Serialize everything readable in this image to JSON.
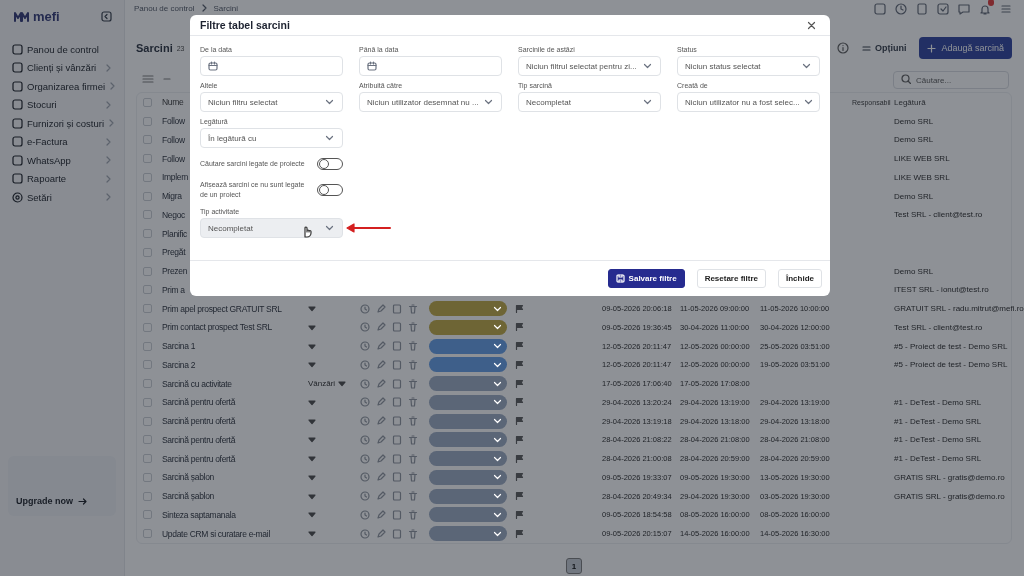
{
  "sidebar": {
    "logo": "mefi",
    "items": [
      {
        "label": "Panou de control",
        "has_submenu": false
      },
      {
        "label": "Clienți și vânzări",
        "has_submenu": true
      },
      {
        "label": "Organizarea firmei",
        "has_submenu": true
      },
      {
        "label": "Stocuri",
        "has_submenu": true
      },
      {
        "label": "Furnizori și costuri",
        "has_submenu": true
      },
      {
        "label": "e-Factura",
        "has_submenu": true
      },
      {
        "label": "WhatsApp",
        "has_submenu": true
      },
      {
        "label": "Rapoarte",
        "has_submenu": true
      },
      {
        "label": "Setări",
        "has_submenu": true
      }
    ],
    "upgrade_link": "Upgrade now"
  },
  "breadcrumb": [
    "Panou de control",
    "Sarcini"
  ],
  "page": {
    "title": "Sarcini",
    "count": "23",
    "options_button": "Opțiuni",
    "add_button": "Adaugă sarcină",
    "search_placeholder": "Căutare..."
  },
  "table": {
    "columns": [
      "Nume",
      "Responsabil",
      "Legătură"
    ],
    "header_checked": false,
    "rows": [
      {
        "kind": "partial",
        "checked": false,
        "name": "Follow",
        "link": "Demo SRL"
      },
      {
        "kind": "partial",
        "checked": false,
        "name": "Follow",
        "link": "Demo SRL"
      },
      {
        "kind": "partial",
        "checked": false,
        "name": "Follow",
        "link": "LIKE WEB SRL"
      },
      {
        "kind": "partial",
        "checked": false,
        "name": "Implem",
        "link": "LIKE WEB SRL"
      },
      {
        "kind": "partial",
        "checked": false,
        "name": "Migra",
        "link": "Demo SRL"
      },
      {
        "kind": "partial",
        "checked": false,
        "name": "Negoc",
        "link": "Test SRL - client@test.ro"
      },
      {
        "kind": "partial",
        "checked": false,
        "name": "Planific"
      },
      {
        "kind": "partial",
        "checked": false,
        "name": "Pregăt"
      },
      {
        "kind": "partial",
        "checked": false,
        "name": "Prezen",
        "link": "Demo SRL"
      },
      {
        "kind": "partial",
        "checked": false,
        "name": "Prim a",
        "link": "ITEST SRL - ionut@test.ro"
      },
      {
        "kind": "full",
        "checked": false,
        "name": "Prim apel prospect GRATUIT SRL",
        "color": "#6e6535",
        "created": "09-05-2026 20:06:18",
        "start": "11-05-2026 09:00:00",
        "end": "11-05-2026 10:00:00",
        "link": "GRATUIT SRL - radu.mitrut@mefi.ro"
      },
      {
        "kind": "full",
        "checked": false,
        "name": "Prim contact prospect Test SRL",
        "color": "#6e6535",
        "created": "09-05-2026 19:36:45",
        "start": "30-04-2026 11:00:00",
        "end": "30-04-2026 12:00:00",
        "link": "Test SRL - client@test.ro"
      },
      {
        "kind": "full",
        "checked": false,
        "name": "Sarcina 1",
        "color": "#3e5f8a",
        "created": "12-05-2026 20:11:47",
        "start": "12-05-2026 00:00:00",
        "end": "25-05-2026 03:51:00",
        "link": "#5 - Proiect de test - Demo SRL"
      },
      {
        "kind": "full",
        "checked": false,
        "name": "Sarcina 2",
        "color": "#3e5f8a",
        "created": "12-05-2026 20:11:47",
        "start": "12-05-2026 00:00:00",
        "end": "19-05-2026 03:51:00",
        "link": "#5 - Proiect de test - Demo SRL"
      },
      {
        "kind": "full",
        "checked": false,
        "name": "Sarcină cu activitate",
        "activity": "Vânzări",
        "color": "#5b6677",
        "created": "17-05-2026 17:06:40",
        "start": "17-05-2026 17:08:00"
      },
      {
        "kind": "full",
        "checked": false,
        "name": "Sarcină pentru ofertă",
        "color": "#5b6677",
        "created": "29-04-2026 13:20:24",
        "start": "29-04-2026 13:19:00",
        "end": "29-04-2026 13:19:00",
        "link": "#1 - DeTest - Demo SRL"
      },
      {
        "kind": "full",
        "checked": false,
        "name": "Sarcină pentru ofertă",
        "color": "#5b6677",
        "created": "29-04-2026 13:19:18",
        "start": "29-04-2026 13:18:00",
        "end": "29-04-2026 13:18:00",
        "link": "#1 - DeTest - Demo SRL"
      },
      {
        "kind": "full",
        "checked": false,
        "name": "Sarcină pentru ofertă",
        "color": "#5b6677",
        "created": "28-04-2026 21:08:22",
        "start": "28-04-2026 21:08:00",
        "end": "28-04-2026 21:08:00",
        "link": "#1 - DeTest - Demo SRL"
      },
      {
        "kind": "full",
        "checked": false,
        "name": "Sarcină pentru ofertă",
        "color": "#5b6677",
        "created": "28-04-2026 21:00:08",
        "start": "28-04-2026 20:59:00",
        "end": "28-04-2026 20:59:00",
        "link": "#1 - DeTest - Demo SRL"
      },
      {
        "kind": "full",
        "checked": false,
        "name": "Sarcină șablon",
        "color": "#5b6677",
        "created": "09-05-2026 19:33:07",
        "start": "09-05-2026 19:30:00",
        "end": "13-05-2026 19:30:00",
        "link": "GRATIS SRL - gratis@demo.ro"
      },
      {
        "kind": "full",
        "checked": false,
        "name": "Sarcină șablon",
        "color": "#5b6677",
        "created": "28-04-2026 20:49:34",
        "start": "29-04-2026 19:30:00",
        "end": "03-05-2026 19:30:00",
        "link": "GRATIS SRL - gratis@demo.ro"
      },
      {
        "kind": "full",
        "checked": false,
        "name": "Sinteza saptamanala",
        "color": "#5b6677",
        "created": "09-05-2026 18:54:58",
        "start": "08-05-2026 16:00:00",
        "end": "08-05-2026 16:00:00"
      },
      {
        "kind": "full",
        "checked": false,
        "name": "Update CRM si curatare e-mail",
        "color": "#5b6677",
        "created": "09-05-2026 20:15:07",
        "start": "14-05-2026 16:00:00",
        "end": "14-05-2026 16:30:00"
      }
    ]
  },
  "pagination": [
    {
      "label": "1",
      "selected": true
    }
  ],
  "dialog": {
    "title": "Filtre tabel sarcini",
    "fields": [
      {
        "kind": "date",
        "label": "De la data",
        "hovered": false
      },
      {
        "kind": "date",
        "label": "Până la data",
        "hovered": false
      },
      {
        "kind": "select",
        "label": "Sarcinile de astăzi",
        "value": "Niciun filtrul selectat pentru zi...",
        "hovered": false
      },
      {
        "kind": "select",
        "label": "Status",
        "value": "Niciun status selectat",
        "hovered": false
      },
      {
        "kind": "select",
        "label": "Altele",
        "value": "Niciun filtru selectat",
        "hovered": false
      },
      {
        "kind": "select",
        "label": "Atribuită către",
        "value": "Niciun utilizator desemnat nu ...",
        "hovered": false
      },
      {
        "kind": "select",
        "label": "Tip sarcină",
        "value": "Necompletat",
        "hovered": false
      },
      {
        "kind": "select",
        "label": "Creată de",
        "value": "Niciun utilizator nu a fost selec...",
        "hovered": false
      },
      {
        "kind": "select",
        "label": "Legătură",
        "value": "În legătură cu",
        "hovered": false
      }
    ],
    "toggles": [
      {
        "label": "Căutare sarcini legate de proiecte",
        "on": false
      },
      {
        "label": "Afișează sarcini ce nu sunt legate de un proiect",
        "on": false
      }
    ],
    "activity_field": {
      "kind": "select",
      "label": "Tip activitate",
      "value": "Necompletat",
      "hovered": true
    },
    "buttons": [
      {
        "kind": "primary",
        "label": "Salvare filtre"
      },
      {
        "kind": "secondary",
        "label": "Resetare filtre"
      },
      {
        "kind": "secondary",
        "label": "Închide"
      }
    ]
  }
}
